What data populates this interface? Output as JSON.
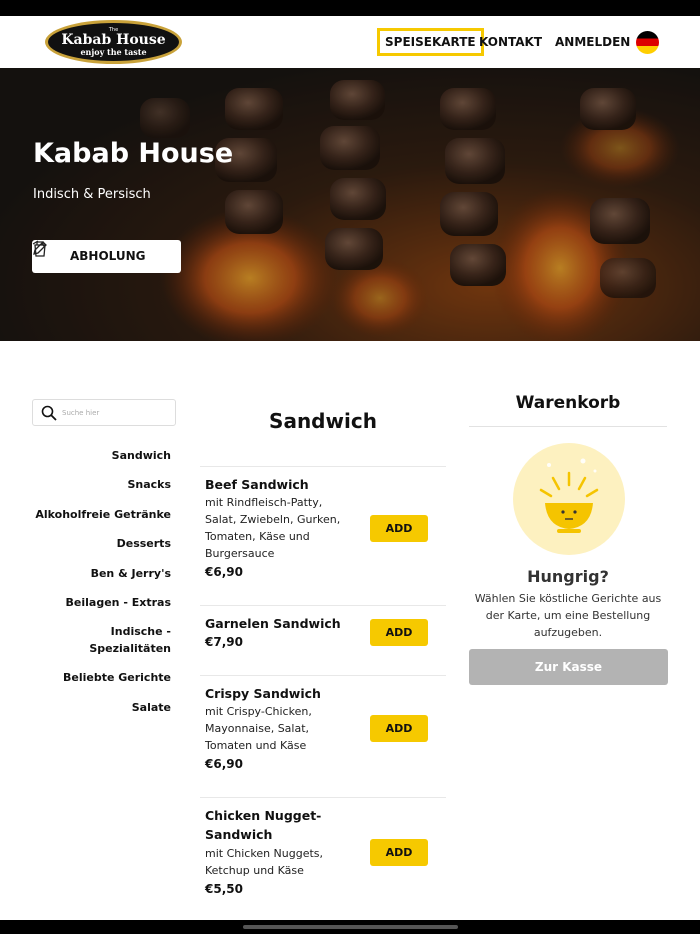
{
  "header": {
    "logo_top": "The",
    "logo_main": "Kabab House",
    "logo_sub": "enjoy the taste",
    "nav": [
      {
        "label": "SPEISEKARTE",
        "active": true
      },
      {
        "label": "KONTAKT"
      },
      {
        "label": "ANMELDEN"
      }
    ],
    "language_icon": "germany-flag-icon",
    "accent_color": "#f6c900"
  },
  "hero": {
    "title": "Kabab House",
    "subtitle": "Indisch & Persisch",
    "order_mode": "ABHOLUNG"
  },
  "search": {
    "placeholder": "Suche hier"
  },
  "categories": [
    "Sandwich",
    "Snacks",
    "Alkoholfreie Getränke",
    "Desserts",
    "Ben & Jerry's",
    "Beilagen - Extras",
    "Indische -",
    "Spezialitäten",
    "Beliebte Gerichte",
    "Salate"
  ],
  "menu": {
    "section_title": "Sandwich",
    "add_label": "ADD",
    "items": [
      {
        "name": "Beef Sandwich",
        "desc": [
          "mit Rindfleisch-Patty,",
          "Salat, Zwiebeln, Gurken,",
          "Tomaten, Käse und",
          "Burgersauce"
        ],
        "price": "€6,90"
      },
      {
        "name": "Garnelen Sandwich",
        "desc": [],
        "price": "€7,90"
      },
      {
        "name": "Crispy Sandwich",
        "desc": [
          "mit Crispy-Chicken,",
          "Mayonnaise, Salat,",
          "Tomaten und Käse"
        ],
        "price": "€6,90"
      },
      {
        "name": "Chicken Nugget-",
        "name2": "Sandwich",
        "desc": [
          "mit Chicken Nuggets,",
          "Ketchup und Käse"
        ],
        "price": "€5,50"
      }
    ]
  },
  "cart": {
    "title": "Warenkorb",
    "empty_title": "Hungrig?",
    "empty_msg": [
      "Wählen Sie köstliche Gerichte aus",
      "der Karte, um eine Bestellung",
      "aufzugeben."
    ],
    "checkout_label": "Zur Kasse",
    "checkout_color": "#b3b3b3"
  }
}
